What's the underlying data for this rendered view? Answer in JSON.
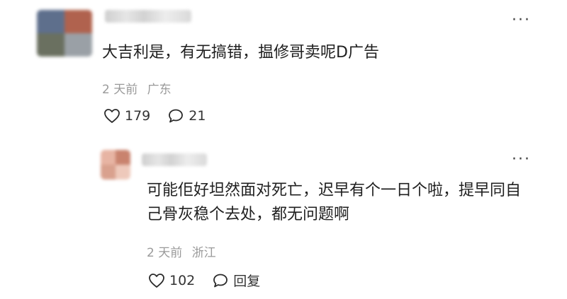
{
  "comments": [
    {
      "text": "大吉利是，有无搞错，揾修哥卖呢D广告",
      "time": "2 天前",
      "location": "广东",
      "likes": "179",
      "replies": "21",
      "more_label": "···",
      "avatar_colors": [
        "#5e6f8c",
        "#b0624e",
        "#6a7060",
        "#9aa0a6"
      ]
    },
    {
      "text": "可能佢好坦然面对死亡，迟早有个一日个啦，提早同自己骨灰稳个去处，都无问题啊",
      "time": "2 天前",
      "location": "浙江",
      "likes": "102",
      "reply_label": "回复",
      "more_label": "···",
      "avatar_colors": [
        "#e7b4a3",
        "#c9836e",
        "#d9a18e",
        "#eec9bb"
      ]
    }
  ],
  "icons": {
    "like": "heart-outline-icon",
    "comment": "chat-bubble-outline-icon",
    "more": "ellipsis-icon"
  }
}
